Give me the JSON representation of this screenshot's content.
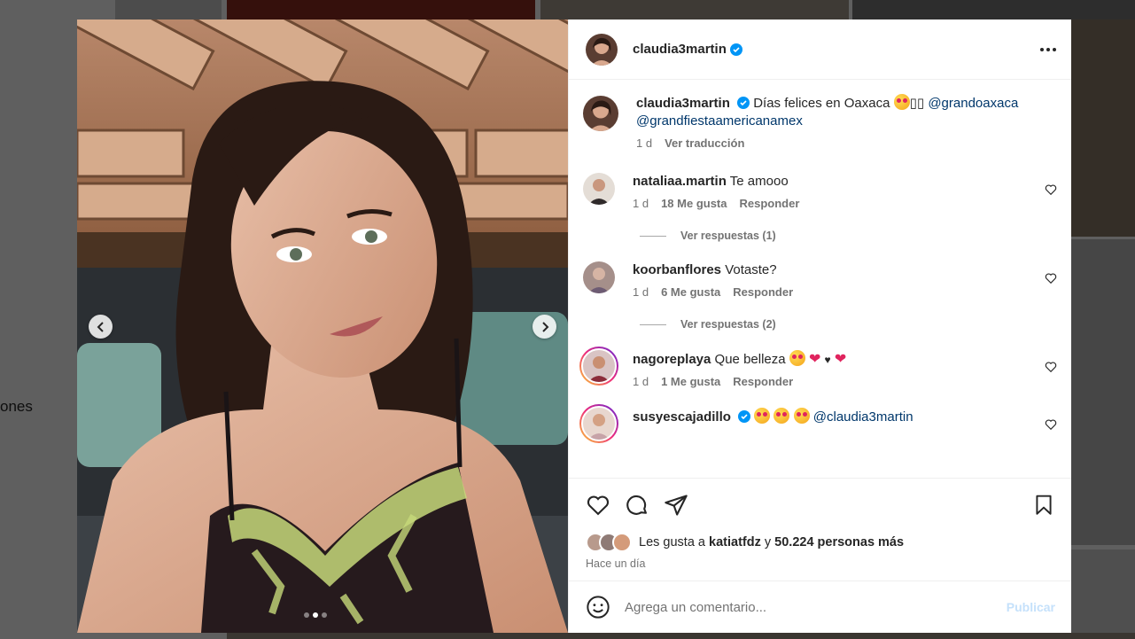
{
  "background": {
    "partial_text": "ones",
    "overlay_color": "#000000"
  },
  "post": {
    "author": "claudia3martin",
    "verified": true,
    "media": {
      "slide_count": 3,
      "active_slide": 2,
      "prev_icon": "chevron-left-icon",
      "next_icon": "chevron-right-icon"
    },
    "caption": {
      "username": "claudia3martin",
      "text": "Días felices en Oaxaca",
      "emoji_suffix": "🤩",
      "boxes": "▯▯",
      "mention1": "@grandoaxaca",
      "mention2": "@grandfiestaamericanamex",
      "time": "1 d",
      "translate": "Ver traducción"
    },
    "comments": [
      {
        "username": "nataliaa.martin",
        "text": "Te amooo",
        "time": "1 d",
        "likes": "18 Me gusta",
        "reply": "Responder",
        "replies": "Ver respuestas (1)"
      },
      {
        "username": "koorbanflores",
        "text": "Votaste?",
        "time": "1 d",
        "likes": "6 Me gusta",
        "reply": "Responder",
        "replies": "Ver respuestas (2)"
      },
      {
        "username": "nagoreplaya",
        "text": "Que belleza",
        "time": "1 d",
        "likes": "1 Me gusta",
        "reply": "Responder",
        "replies": ""
      },
      {
        "username": "susyescajadillo",
        "text": "",
        "mention": "@claudia3martin",
        "time": "",
        "likes": "",
        "reply": "",
        "replies": ""
      }
    ],
    "likes": {
      "prefix": "Les gusta a",
      "first_user": "katiatfdz",
      "connector": "y",
      "others": "50.224 personas más"
    },
    "time_ago": "Hace un día",
    "add_comment": {
      "placeholder": "Agrega un comentario...",
      "publish": "Publicar"
    }
  },
  "colors": {
    "text": "#262626",
    "secondary": "#737373",
    "link": "#00376b",
    "verified": "#0095f6",
    "publish_disabled": "#c5e1fb"
  }
}
